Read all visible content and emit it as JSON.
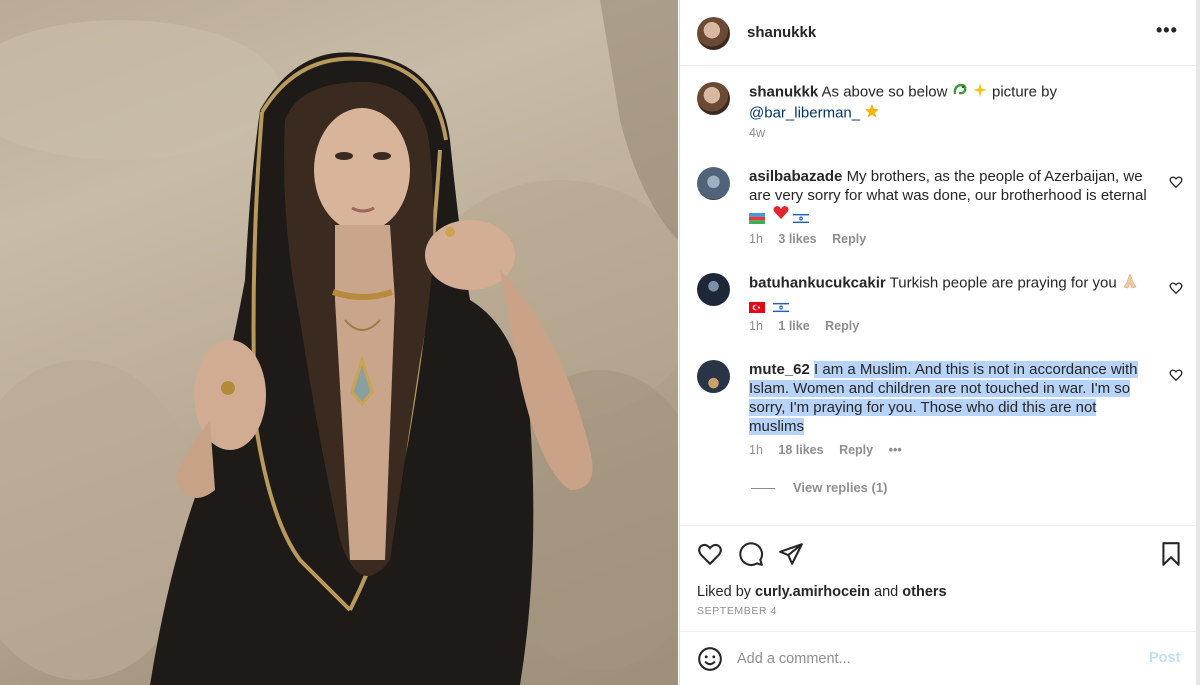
{
  "post": {
    "username": "shanukkk",
    "more_label": "•••",
    "caption": {
      "username": "shanukkk",
      "text_line1": "As above so below",
      "text_line1_tail": "picture by",
      "mention": "@bar_liberman_",
      "time": "4w"
    }
  },
  "comments": [
    {
      "username": "asilbabazade",
      "text_line1": "My brothers, as the people of Azerbaijan, we",
      "text_line2": "are very sorry for what was done, our brotherhood is eternal",
      "time": "1h",
      "likes": "3 likes",
      "reply": "Reply"
    },
    {
      "username": "batuhankucukcakir",
      "text_line1": "Turkish people are praying for you",
      "time": "1h",
      "likes": "1 like",
      "reply": "Reply"
    },
    {
      "username": "mute_62",
      "text_line1": "I am a Muslim. And this is not in accordance with",
      "text_line2": "Islam. Women and children are not touched in war. I'm so",
      "text_line3": "sorry, I'm praying for you. Those who did this are not",
      "text_line4": "muslims",
      "time": "1h",
      "likes": "18 likes",
      "reply": "Reply",
      "more": "•••",
      "view_replies": "View replies (1)"
    }
  ],
  "actions": {
    "liked_prefix": "Liked by",
    "liked_user": "curly.amirhocein",
    "liked_and": "and",
    "liked_others": "others",
    "date": "SEPTEMBER 4"
  },
  "composer": {
    "placeholder": "Add a comment...",
    "post_label": "Post"
  },
  "colors": {
    "highlight": "#b7d3f8",
    "post_disabled": "#c0dffd",
    "muted_text": "#8e8e8e"
  }
}
